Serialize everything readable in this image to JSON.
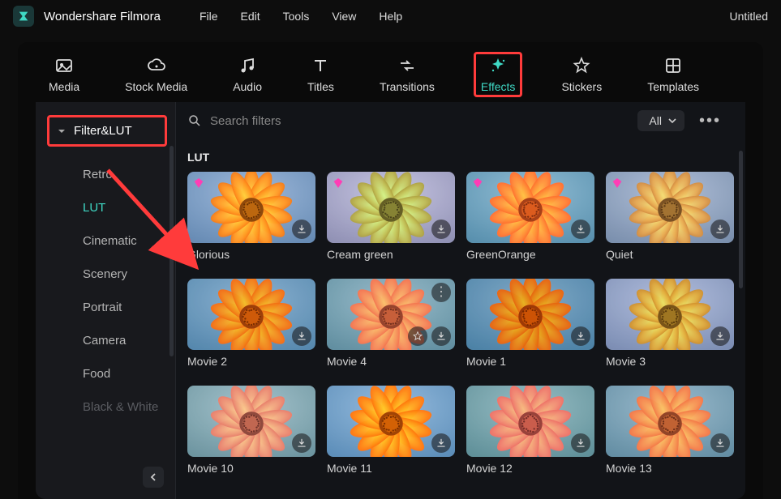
{
  "app": {
    "title": "Wondershare Filmora",
    "doc_title": "Untitled"
  },
  "menubar": {
    "items": [
      "File",
      "Edit",
      "Tools",
      "View",
      "Help"
    ]
  },
  "tool_tabs": {
    "items": [
      {
        "label": "Media",
        "icon": "image-icon"
      },
      {
        "label": "Stock Media",
        "icon": "cloud-image-icon"
      },
      {
        "label": "Audio",
        "icon": "music-note-icon"
      },
      {
        "label": "Titles",
        "icon": "text-icon"
      },
      {
        "label": "Transitions",
        "icon": "arrows-icon"
      },
      {
        "label": "Effects",
        "icon": "sparkle-icon",
        "active": true
      },
      {
        "label": "Stickers",
        "icon": "shape-star-icon"
      },
      {
        "label": "Templates",
        "icon": "grid-icon"
      }
    ]
  },
  "sidebar": {
    "header": "Filter&LUT",
    "items": [
      {
        "label": "Retro"
      },
      {
        "label": "LUT",
        "active": true
      },
      {
        "label": "Cinematic"
      },
      {
        "label": "Scenery"
      },
      {
        "label": "Portrait"
      },
      {
        "label": "Camera"
      },
      {
        "label": "Food"
      },
      {
        "label": "Black & White"
      }
    ]
  },
  "content": {
    "search_placeholder": "Search filters",
    "filter_label": "All",
    "section_title": "LUT",
    "items": [
      {
        "label": "Glorious",
        "premium": true,
        "hue": 0,
        "sat": 1.1,
        "bright": 1.0
      },
      {
        "label": "Cream green",
        "premium": true,
        "hue": 30,
        "sat": 0.6,
        "bright": 1.1
      },
      {
        "label": "GreenOrange",
        "premium": true,
        "hue": -15,
        "sat": 1.2,
        "bright": 1.0
      },
      {
        "label": "Quiet",
        "premium": true,
        "hue": 5,
        "sat": 0.7,
        "bright": 1.05
      },
      {
        "label": "Movie 2",
        "premium": false,
        "hue": -8,
        "sat": 1.3,
        "bright": 0.95
      },
      {
        "label": "Movie 4",
        "premium": false,
        "hue": -20,
        "sat": 0.9,
        "bright": 1.0,
        "opts": true
      },
      {
        "label": "Movie 1",
        "premium": false,
        "hue": -10,
        "sat": 1.4,
        "bright": 0.9
      },
      {
        "label": "Movie 3",
        "premium": false,
        "hue": 12,
        "sat": 0.8,
        "bright": 1.05
      },
      {
        "label": "Movie 10",
        "premium": false,
        "hue": -25,
        "sat": 0.7,
        "bright": 1.05
      },
      {
        "label": "Movie 11",
        "premium": false,
        "hue": -5,
        "sat": 1.3,
        "bright": 1.0
      },
      {
        "label": "Movie 12",
        "premium": false,
        "hue": -30,
        "sat": 0.85,
        "bright": 1.0
      },
      {
        "label": "Movie 13",
        "premium": false,
        "hue": -15,
        "sat": 0.9,
        "bright": 1.0
      }
    ]
  },
  "colors": {
    "accent": "#3fd9c5",
    "highlight_box": "#ff3b3b",
    "premium": "#ff3db5"
  }
}
